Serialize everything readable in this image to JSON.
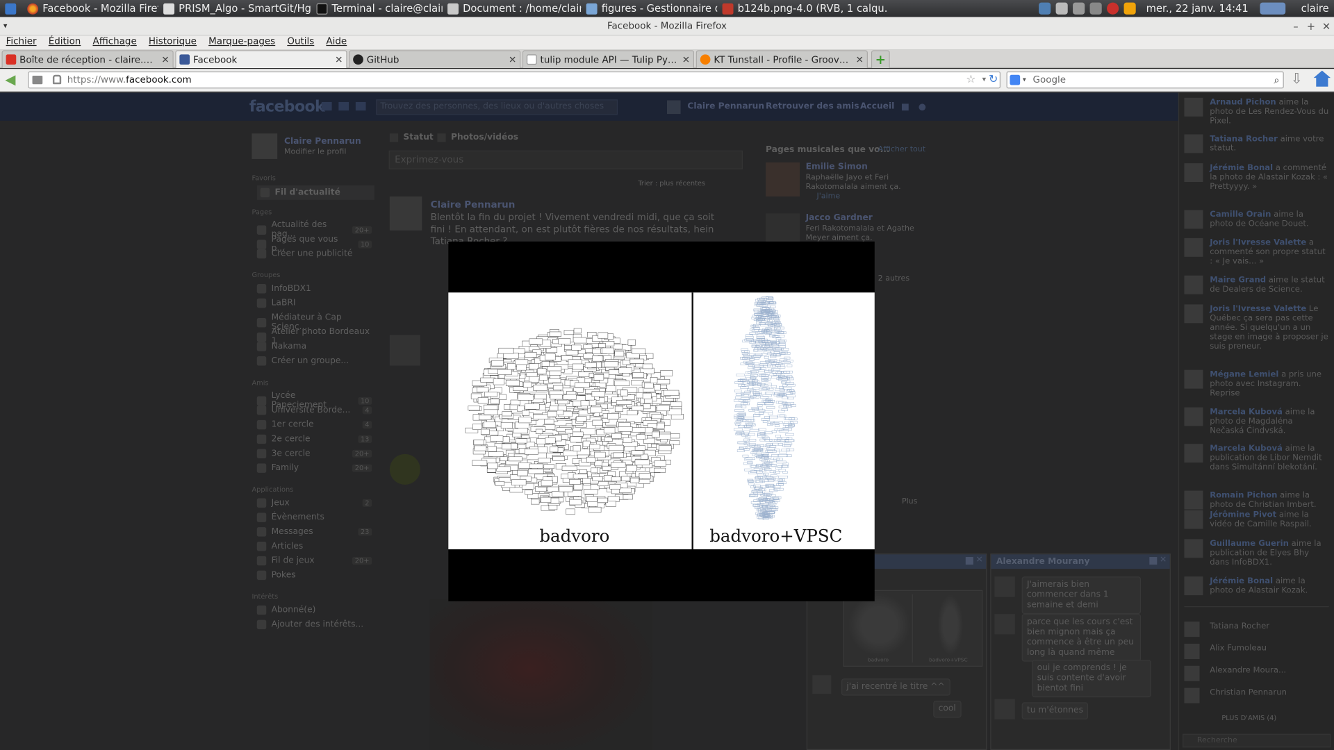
{
  "taskbar": {
    "tasks": [
      "Facebook - Mozilla Firefox",
      "PRISM_Algo - SmartGit/Hg 4...",
      "Terminal - claire@claire-Syst...",
      "Document : /home/claire/D...",
      "figures - Gestionnaire de fic...",
      "b124b.png-4.0 (RVB, 1 calqu..."
    ],
    "clock": "mer., 22 janv. 14:41",
    "user": "claire"
  },
  "window": {
    "title": "Facebook - Mozilla Firefox"
  },
  "menubar": [
    "Fichier",
    "Édition",
    "Affichage",
    "Historique",
    "Marque-pages",
    "Outils",
    "Aide"
  ],
  "tabs": [
    {
      "label": "Boîte de réception - claire.penna...",
      "icon": "gmail-icon",
      "color": "#d93025"
    },
    {
      "label": "Facebook",
      "icon": "facebook-icon",
      "color": "#3b5998"
    },
    {
      "label": "GitHub",
      "icon": "github-icon",
      "color": "#222222"
    },
    {
      "label": "tulip module API — Tulip Pytho...",
      "icon": "page-icon",
      "color": "#9a9a9a"
    },
    {
      "label": "KT Tunstall - Profile - Grooveshark",
      "icon": "grooveshark-icon",
      "color": "#f77f00"
    }
  ],
  "navbar": {
    "url_prefix": "https://www.",
    "url_domain": "facebook.com",
    "url_suffix": ".com",
    "search_placeholder": "Google"
  },
  "facebook": {
    "logo": "facebook",
    "search_placeholder": "Trouvez des personnes, des lieux ou d'autres choses",
    "user": "Claire Pennarun",
    "nav_find_friends": "Retrouver des amis",
    "nav_home": "Accueil",
    "edit_profile": "Modifier le profil",
    "left_sections": {
      "favoris": "Favoris",
      "pages": "Pages",
      "groupes": "Groupes",
      "amis": "Amis",
      "applications": "Applications",
      "interets": "Intérêts"
    },
    "left_items": [
      {
        "label": "Fil d'actualité",
        "count": ""
      },
      {
        "label": "Actualité des pag...",
        "count": "20+"
      },
      {
        "label": "Pages que vous p...",
        "count": "10"
      },
      {
        "label": "Créer une publicité",
        "count": ""
      },
      {
        "label": "InfoBDX1",
        "count": ""
      },
      {
        "label": "LaBRI",
        "count": ""
      },
      {
        "label": "Médiateur à Cap Scienc...",
        "count": ""
      },
      {
        "label": "Atelier photo Bordeaux 1",
        "count": ""
      },
      {
        "label": "Nakama",
        "count": ""
      },
      {
        "label": "Créer un groupe...",
        "count": ""
      },
      {
        "label": "Lycée Papeciement",
        "count": "10"
      },
      {
        "label": "Université Borde...",
        "count": "4"
      },
      {
        "label": "1er cercle",
        "count": "4"
      },
      {
        "label": "2e cercle",
        "count": "13"
      },
      {
        "label": "3e cercle",
        "count": "20+"
      },
      {
        "label": "Family",
        "count": "20+"
      },
      {
        "label": "Jeux",
        "count": "2"
      },
      {
        "label": "Évènements",
        "count": ""
      },
      {
        "label": "Messages",
        "count": "23"
      },
      {
        "label": "Articles",
        "count": ""
      },
      {
        "label": "Fil de jeux",
        "count": "20+"
      },
      {
        "label": "Pokes",
        "count": ""
      },
      {
        "label": "Abonné(e)",
        "count": ""
      },
      {
        "label": "Ajouter des intérêts...",
        "count": ""
      }
    ],
    "composer": {
      "status": "Statut",
      "photos": "Photos/vidéos",
      "placeholder": "Exprimez-vous"
    },
    "sort_label": "Trier : plus récentes",
    "post": {
      "author": "Claire Pennarun",
      "text": "Blentôt la fin du projet ! Vivement vendredi midi, que ça soit fini ! En attendant, on est plutôt fières de nos résultats, hein Tatiana Rocher ?"
    },
    "right_col": {
      "header": "Pages musicales que vo...",
      "header_link": "Afficher tout",
      "items": [
        {
          "name": "Emilie Simon",
          "text": "Raphaëlle Jayo et Feri Rakotomalala aiment ça.",
          "like": "J'aime"
        },
        {
          "name": "Jacco Gardner",
          "text": "Feri Rakotomalala et Agathe Meyer aiment ça."
        }
      ],
      "others": "2 autres",
      "plus": "Plus"
    },
    "ticker": [
      {
        "name": "Arnaud Pichon",
        "text": "aime la photo de Les Rendez-Vous du Pixel."
      },
      {
        "name": "Tatiana Rocher",
        "text": "aime votre statut."
      },
      {
        "name": "Jérémie Bonal",
        "text": "a commenté la photo de Alastair Kozak : « Prettyyyy. »"
      },
      {
        "name": "Camille Orain",
        "text": "aime la photo de Océane Douet."
      },
      {
        "name": "Joris l'Ivresse Valette",
        "text": "a commenté son propre statut : « Je vais... »"
      },
      {
        "name": "Maire Grand",
        "text": "aime le statut de Dealers de Science."
      },
      {
        "name": "Joris l'Ivresse Valette",
        "text": "Le Québec ça sera pas cette année. Si quelqu'un a un stage en image à proposer je suis preneur."
      },
      {
        "name": "Mégane Lemiel",
        "text": "a pris une photo avec Instagram. Reprise"
      },
      {
        "name": "Marcela Kubová",
        "text": "aime la photo de Magdaléna Nečaská Čindvská."
      },
      {
        "name": "Marcela Kubová",
        "text": "aime la publication de Libor Nemdit dans Simultánní blekotání."
      },
      {
        "name": "Romain Pichon",
        "text": "aime la photo de Christian Imbert."
      },
      {
        "name": "Jérômine Pivot",
        "text": "aime la vidéo de Camille Raspail."
      },
      {
        "name": "Guillaume Guerin",
        "text": "aime la publication de Elyes Bhy dans InfoBDX1."
      },
      {
        "name": "Jérémie Bonal",
        "text": "aime la photo de Alastair Kozak."
      }
    ],
    "online": [
      "Tatiana Rocher",
      "Alix Fumoleau",
      "Alexandre Moura...",
      "Christian Pennarun"
    ],
    "online_more": "PLUS D'AMIS (4)",
    "search_chat": "Recherche",
    "chat1": {
      "title": "Alexandre Mourany",
      "messages": [
        "J'aimerais bien commencer dans 1 semaine et demi",
        "parce que les cours c'est bien mignon mais ça commence à être un peu long là quand même",
        "oui je comprends ! je suis contente d'avoir bientot fini",
        "tu m'étonnes"
      ]
    },
    "chat2": {
      "messages": [
        "j'ai recentré le titre ^^",
        "cool"
      ],
      "thumb_left": "badvoro",
      "thumb_right": "badvoro+VPSC"
    }
  },
  "lightbox": {
    "left_caption": "badvoro",
    "right_caption": "badvoro+VPSC"
  }
}
